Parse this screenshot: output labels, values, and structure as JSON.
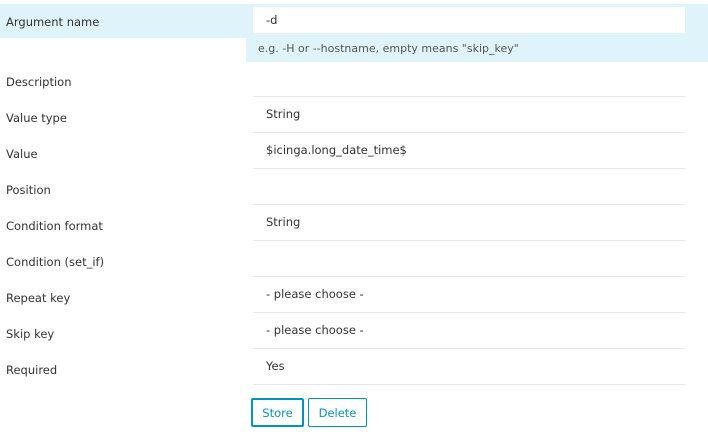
{
  "form": {
    "argument_name": {
      "label": "Argument name",
      "value": "-d",
      "hint": "e.g. -H or --hostname, empty means \"skip_key\""
    },
    "rows": [
      {
        "label": "Description",
        "value": ""
      },
      {
        "label": "Value type",
        "value": "String"
      },
      {
        "label": "Value",
        "value": "$icinga.long_date_time$"
      },
      {
        "label": "Position",
        "value": ""
      },
      {
        "label": "Condition format",
        "value": "String"
      },
      {
        "label": "Condition (set_if)",
        "value": ""
      },
      {
        "label": "Repeat key",
        "value": "- please choose -"
      },
      {
        "label": "Skip key",
        "value": "- please choose -"
      },
      {
        "label": "Required",
        "value": "Yes"
      }
    ]
  },
  "buttons": {
    "store_label": "Store",
    "delete_label": "Delete"
  }
}
